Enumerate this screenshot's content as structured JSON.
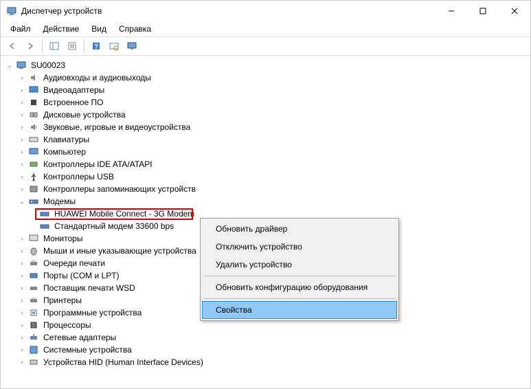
{
  "window": {
    "title": "Диспетчер устройств"
  },
  "menu": {
    "file": "Файл",
    "action": "Действие",
    "view": "Вид",
    "help": "Справка"
  },
  "tree": {
    "root": "SU00023",
    "nodes": {
      "audio": "Аудиовходы и аудиовыходы",
      "video": "Видеоадаптеры",
      "firmware": "Встроенное ПО",
      "disk": "Дисковые устройства",
      "sound": "Звуковые, игровые и видеоустройства",
      "keyboard": "Клавиатуры",
      "computer": "Компьютер",
      "ide": "Контроллеры IDE ATA/ATAPI",
      "usb": "Контроллеры USB",
      "storage": "Контроллеры запоминающих устройств",
      "modems": "Модемы",
      "modem_huawei": "HUAWEI Mobile Connect - 3G Modem",
      "modem_std": "Стандартный модем 33600 bps",
      "monitors": "Мониторы",
      "mice": "Мыши и иные указывающие устройства",
      "printqueue": "Очереди печати",
      "ports": "Порты (COM и LPT)",
      "wsd": "Поставщик печати WSD",
      "printers": "Принтеры",
      "software": "Программные устройства",
      "cpu": "Процессоры",
      "net": "Сетевые адаптеры",
      "system": "Системные устройства",
      "hid": "Устройства HID (Human Interface Devices)"
    }
  },
  "context_menu": {
    "update_driver": "Обновить драйвер",
    "disable": "Отключить устройство",
    "remove": "Удалить устройство",
    "scan": "Обновить конфигурацию оборудования",
    "properties": "Свойства"
  }
}
